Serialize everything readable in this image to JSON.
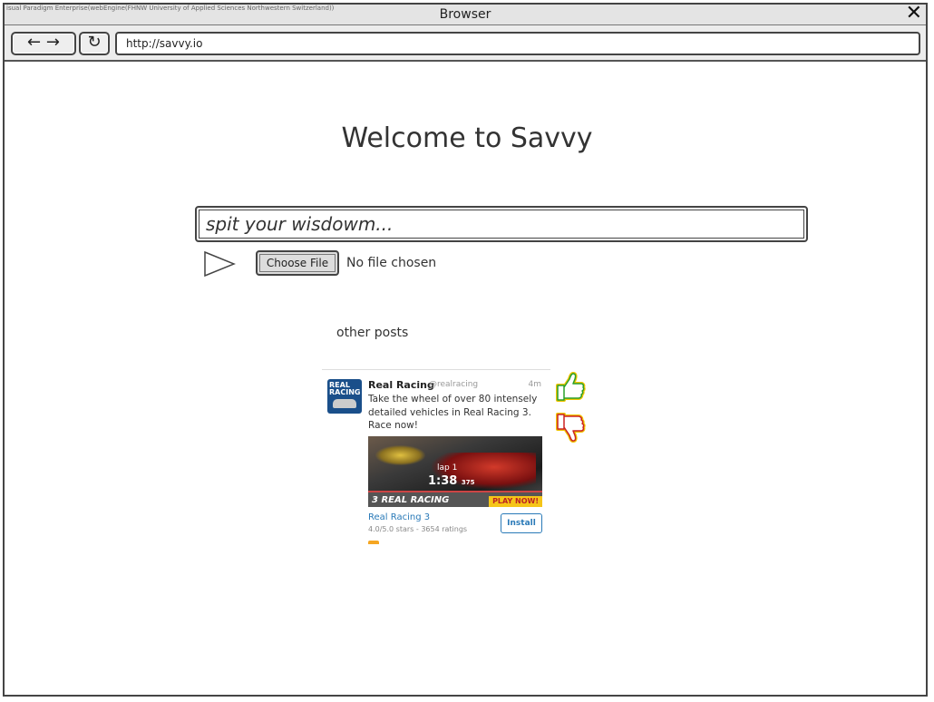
{
  "window": {
    "watermark": "isual Paradigm Enterprise(webEngine(FHNW University of Applied Sciences Northwestern Switzerland))",
    "title": "Browser",
    "close_glyph": "✕"
  },
  "toolbar": {
    "back_forward_glyph": "← →",
    "reload_glyph": "↻",
    "url": "http://savvy.io"
  },
  "page": {
    "heading": "Welcome to Savvy",
    "post_input_placeholder": "spit your wisdowm...",
    "choose_file_label": "Choose File",
    "no_file_text": "No file chosen",
    "other_posts_label": "other posts"
  },
  "post": {
    "avatar_text": "REAL RACING",
    "account_name": "Real Racing",
    "handle": "@realracing",
    "time": "4m",
    "text": "Take the wheel of over 80 intensely detailed vehicles in Real Racing 3. Race now!",
    "image": {
      "lap_text": "lap 1",
      "lap_time": "1:38",
      "lap_time_ms": "375",
      "game_logo": "3 REAL RACING",
      "play_now": "PLAY NOW!"
    },
    "app_name": "Real Racing 3",
    "rating": "4.0/5.0 stars - 3654 ratings",
    "install_label": "Install"
  },
  "colors": {
    "thumb_up_stroke": "#2aa02a",
    "thumb_down_stroke": "#cc2222",
    "thumb_outline": "#f0c400"
  },
  "icons": {
    "send": "send-arrow-icon",
    "like": "thumbs-up-icon",
    "dislike": "thumbs-down-icon"
  }
}
